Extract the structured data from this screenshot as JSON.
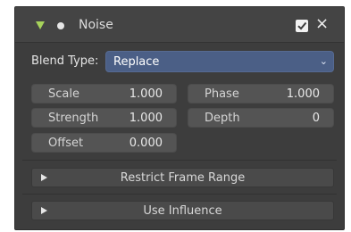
{
  "modifier": {
    "title": "Noise",
    "enabled": true,
    "close_icon": "×",
    "accent_color": "#a7d35b"
  },
  "blend": {
    "label": "Blend Type:",
    "value": "Replace",
    "chevron": "⌄"
  },
  "fields": {
    "scale": {
      "label": "Scale",
      "value": "1.000"
    },
    "phase": {
      "label": "Phase",
      "value": "1.000"
    },
    "strength": {
      "label": "Strength",
      "value": "1.000"
    },
    "depth": {
      "label": "Depth",
      "value": "0"
    },
    "offset": {
      "label": "Offset",
      "value": "0.000"
    }
  },
  "subpanels": {
    "restrict": "Restrict Frame Range",
    "influence": "Use Influence"
  }
}
